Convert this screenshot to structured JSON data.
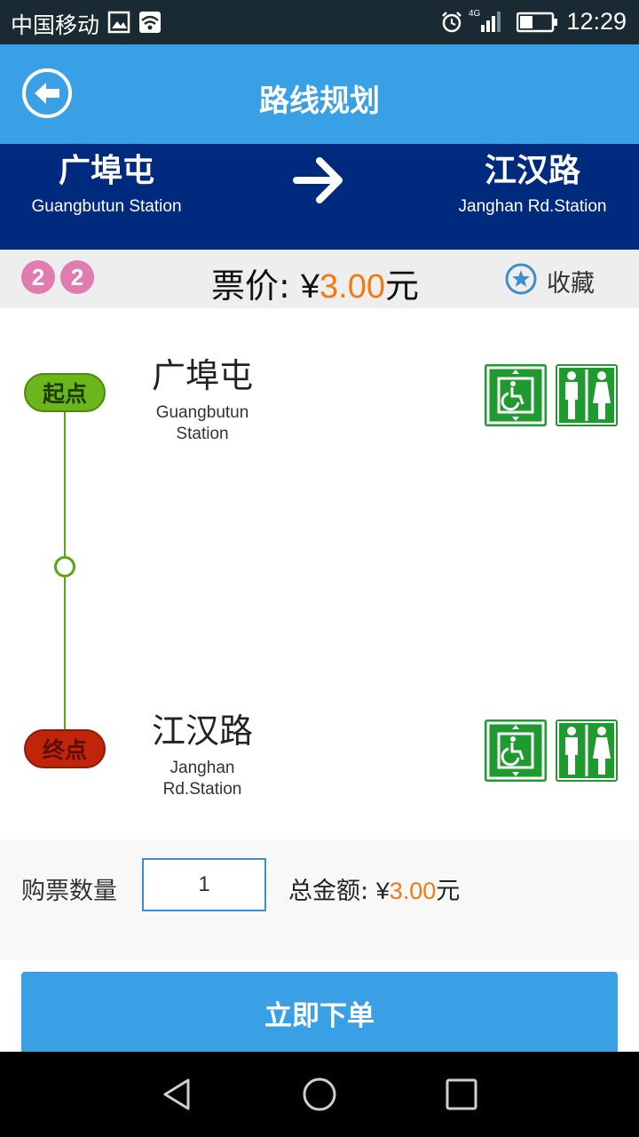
{
  "status_bar": {
    "carrier": "中国移动",
    "network": "4G",
    "time": "12:29"
  },
  "app_bar": {
    "title": "路线规划",
    "back_icon": "back-arrow-circle-icon"
  },
  "route": {
    "from": {
      "cn": "广埠屯",
      "en": "Guangbutun Station"
    },
    "to": {
      "cn": "江汉路",
      "en": "Janghan Rd.Station"
    }
  },
  "fare": {
    "line_badges": [
      "2",
      "2"
    ],
    "label": "票价:",
    "currency": "¥",
    "amount": "3.00",
    "unit": "元",
    "favorite_label": "收藏"
  },
  "detail": {
    "start_pill": "起点",
    "end_pill": "终点",
    "start_station": {
      "cn": "广埠屯",
      "en_line1": "Guangbutun",
      "en_line2": "Station"
    },
    "end_station": {
      "cn": "江汉路",
      "en_line1": "Janghan",
      "en_line2": "Rd.Station"
    },
    "facility_icons": [
      "accessible-elevator-icon",
      "restroom-icon"
    ]
  },
  "order": {
    "qty_label": "购票数量",
    "qty_value": "1",
    "total_label": "总金额:",
    "currency": "¥",
    "total_amount": "3.00",
    "unit": "元",
    "submit_label": "立即下单"
  },
  "colors": {
    "primary": "#3aa0e6",
    "banner": "#002a7e",
    "price_accent": "#f07a13",
    "start_green": "#6cb51a",
    "end_red": "#c0250a",
    "facility_green": "#1e9a2e",
    "line_badge": "#e07cb0"
  }
}
